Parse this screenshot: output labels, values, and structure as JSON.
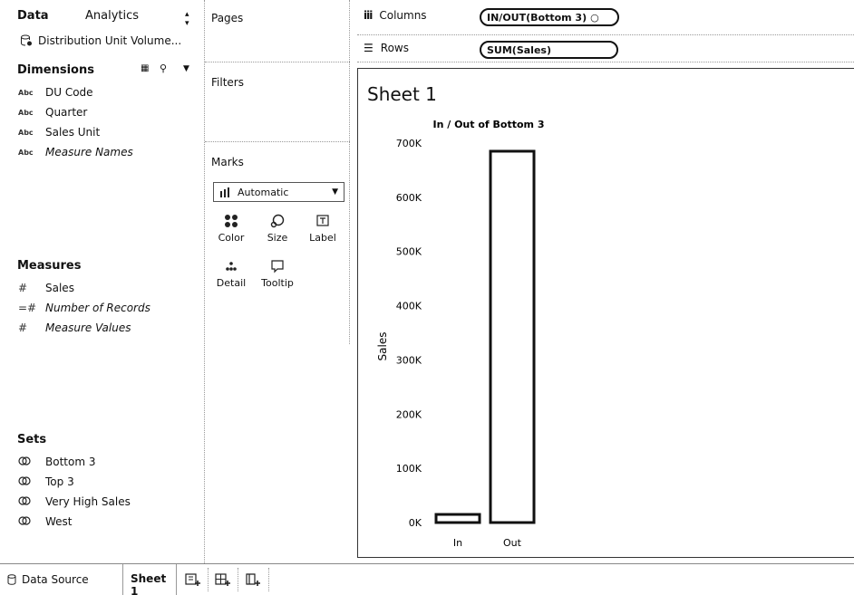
{
  "data_pane": {
    "tab_data": "Data",
    "tab_analytics": "Analytics",
    "datasource": "Distribution Unit Volume...",
    "dimensions_title": "Dimensions",
    "dimensions": [
      {
        "type": "Abc",
        "label": "DU Code",
        "italic": false
      },
      {
        "type": "Abc",
        "label": "Quarter",
        "italic": false
      },
      {
        "type": "Abc",
        "label": "Sales Unit",
        "italic": false
      },
      {
        "type": "Abc",
        "label": "Measure Names",
        "italic": true
      }
    ],
    "measures_title": "Measures",
    "measures": [
      {
        "type": "#",
        "label": "Sales",
        "italic": false
      },
      {
        "type": "=#",
        "label": "Number of Records",
        "italic": true
      },
      {
        "type": "#",
        "label": "Measure Values",
        "italic": true
      }
    ],
    "sets_title": "Sets",
    "sets": [
      {
        "label": "Bottom 3"
      },
      {
        "label": "Top 3"
      },
      {
        "label": "Very High Sales"
      },
      {
        "label": "West"
      }
    ]
  },
  "cards": {
    "pages": "Pages",
    "filters": "Filters",
    "marks": "Marks",
    "mark_type": "Automatic",
    "buttons": {
      "color": "Color",
      "size": "Size",
      "label": "Label",
      "detail": "Detail",
      "tooltip": "Tooltip"
    }
  },
  "shelves": {
    "columns_label": "Columns",
    "columns_pill": "IN/OUT(Bottom 3)",
    "rows_label": "Rows",
    "rows_pill": "SUM(Sales)"
  },
  "view": {
    "sheet_title": "Sheet 1"
  },
  "chart_data": {
    "type": "bar",
    "title": "In / Out of Bottom 3",
    "ylabel": "Sales",
    "categories": [
      "In",
      "Out"
    ],
    "values": [
      15000,
      685000
    ],
    "ylim": [
      0,
      700000
    ],
    "yticks": [
      "0K",
      "100K",
      "200K",
      "300K",
      "400K",
      "500K",
      "600K",
      "700K"
    ],
    "bar_fill": "#ffffff",
    "bar_stroke": "#111111"
  },
  "tabs": {
    "data_source": "Data Source",
    "sheet": "Sheet 1"
  }
}
